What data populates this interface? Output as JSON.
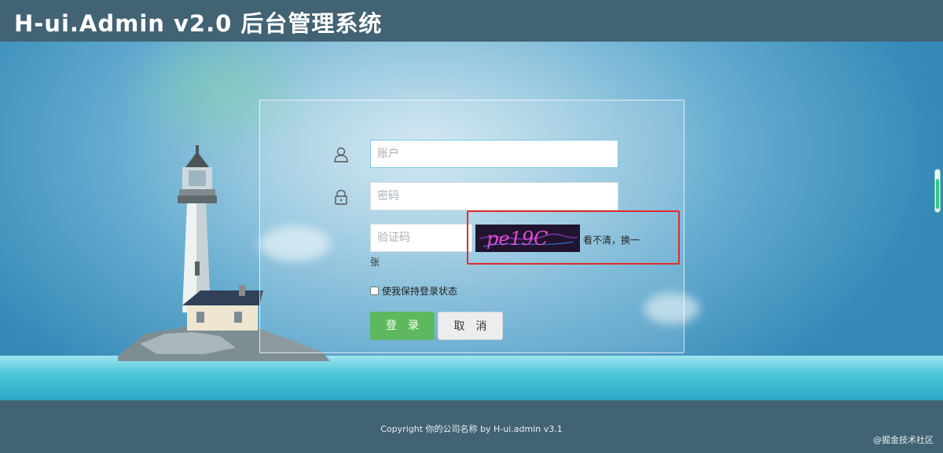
{
  "header": {
    "title": "H-ui.Admin v2.0 后台管理系统"
  },
  "login": {
    "account_placeholder": "账户",
    "password_placeholder": "密码",
    "captcha_placeholder": "验证码",
    "captcha_text": "pe19C",
    "captcha_refresh_line1": "看不清，换一",
    "captcha_refresh_line2": "张",
    "remember_label": "使我保持登录状态",
    "remember_checked": false,
    "login_label": "登录",
    "cancel_label": "取消"
  },
  "footer": {
    "copyright": "Copyright 你的公司名称 by H-ui.admin v3.1",
    "watermark": "@掘金技术社区"
  },
  "colors": {
    "header_bg": "#426374",
    "login_button": "#5eb95e",
    "highlight_border": "#e02b2b"
  }
}
